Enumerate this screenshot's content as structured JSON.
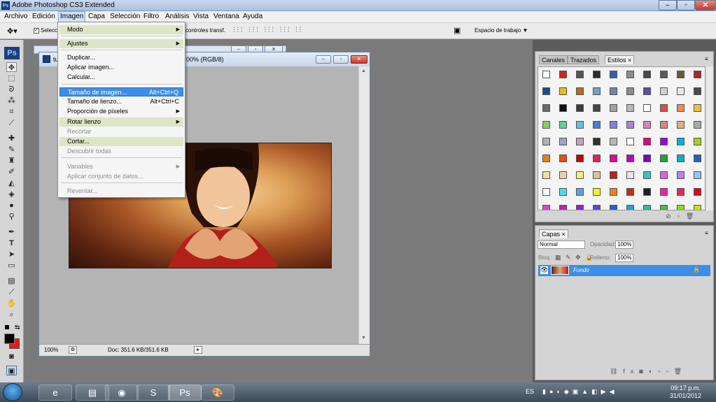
{
  "window": {
    "title": "Adobe Photoshop CS3 Extended",
    "app_icon": "Ps",
    "controls": [
      "minimize",
      "maximize",
      "close"
    ]
  },
  "menubar": [
    "Archivo",
    "Edición",
    "Imagen",
    "Capa",
    "Selección",
    "Filtro",
    "Análisis",
    "Vista",
    "Ventana",
    "Ayuda"
  ],
  "options_bar": {
    "select_label": "Selecci",
    "controls_label": "controles transf.",
    "workspace_label": "Espacio de trabajo ▼"
  },
  "image_menu": {
    "items": [
      {
        "label": "Modo",
        "shortcut": "",
        "submenu": true,
        "state": "submenu"
      },
      {
        "label": "Ajustes",
        "shortcut": "",
        "submenu": true,
        "state": "submenu"
      },
      {
        "label": "Duplicar...",
        "shortcut": "",
        "submenu": false,
        "state": "normal"
      },
      {
        "label": "Aplicar imagen...",
        "shortcut": "",
        "submenu": false,
        "state": "normal"
      },
      {
        "label": "Calcular...",
        "shortcut": "",
        "submenu": false,
        "state": "normal"
      },
      {
        "label": "Tamaño de imagen...",
        "shortcut": "Alt+Ctrl+Q",
        "submenu": false,
        "state": "highlighted"
      },
      {
        "label": "Tamaño de lienzo...",
        "shortcut": "Alt+Ctrl+C",
        "submenu": false,
        "state": "normal"
      },
      {
        "label": "Proporción de píxeles",
        "shortcut": "",
        "submenu": true,
        "state": "normal"
      },
      {
        "label": "Rotar lienzo",
        "shortcut": "",
        "submenu": true,
        "state": "submenu"
      },
      {
        "label": "Recortar",
        "shortcut": "",
        "submenu": false,
        "state": "disabled"
      },
      {
        "label": "Cortar...",
        "shortcut": "",
        "submenu": false,
        "state": "submenu"
      },
      {
        "label": "Descubrir todas",
        "shortcut": "",
        "submenu": false,
        "state": "disabled"
      },
      {
        "label": "Variables",
        "shortcut": "",
        "submenu": true,
        "state": "disabled"
      },
      {
        "label": "Aplicar conjunto de datos...",
        "shortcut": "",
        "submenu": false,
        "state": "disabled"
      },
      {
        "label": "Reventar...",
        "shortcut": "",
        "submenu": false,
        "state": "disabled"
      }
    ]
  },
  "document": {
    "title_prefix": "tu",
    "title_suffix": "00% (RGB/8)",
    "zoom": "100%",
    "doc_size": "Doc: 351.6 KB/351.6 KB"
  },
  "styles_panel": {
    "tabs": [
      "Canales",
      "Trazados",
      "Estilos ×"
    ],
    "active_tab": 2,
    "swatches": [
      [
        "#ffffff",
        "#c8281e",
        "#555555",
        "#2b2b2b",
        "#2f63a8",
        "#8c8c8c",
        "#4a4a4a",
        "#5a5a5a",
        "#6b5a32",
        "#b3212b"
      ],
      [
        "#1a4b8c",
        "#e0c01a",
        "#b56a25",
        "#6fa0d0",
        "#6b86a8",
        "#8c8c8c",
        "#5b4ea0",
        "#cfcfcf",
        "#e8e8e8",
        "#4a4a4a"
      ],
      [
        "#6a6a6a",
        "#111111",
        "#3c3c3c",
        "#454545",
        "#a0a0a0",
        "#b8b8b8",
        "#ffffff",
        "#dd4a4a",
        "#f08c50",
        "#f0c040"
      ],
      [
        "#80d060",
        "#60d0a0",
        "#60c0e0",
        "#4080e0",
        "#8080e0",
        "#b080e0",
        "#e080c0",
        "#e08080",
        "#e0b080",
        "#a0b0a0"
      ],
      [
        "#b0b0b0",
        "#a0a8c0",
        "#c0a0c0",
        "#303030",
        "#b8b8b8",
        "#ffffff",
        "#e00080",
        "#a000e0",
        "#00b0e0",
        "#a0d020"
      ],
      [
        "#e08020",
        "#e05000",
        "#c00000",
        "#e02060",
        "#e000a0",
        "#c000c0",
        "#8000c0",
        "#20a040",
        "#00b0c0",
        "#2060c0"
      ],
      [
        "#f0e0a0",
        "#f0d0b0",
        "#f0f080",
        "#e0c0a0",
        "#c02020",
        "#f0e0f0",
        "#40c0c0",
        "#e060e0",
        "#c080f0",
        "#a0c0f0"
      ],
      [
        "#ffffff",
        "#40e0f0",
        "#60a0e0",
        "#f0f020",
        "#f08020",
        "#c03010",
        "#202020",
        "#f020a0",
        "#f02060",
        "#e00020"
      ],
      [
        "#e040e0",
        "#c020c0",
        "#9020e0",
        "#6040e0",
        "#2060e0",
        "#20a0e0",
        "#20c0a0",
        "#40c040",
        "#80e020",
        "#c0e020"
      ]
    ]
  },
  "layers_panel": {
    "tab": "Capas ×",
    "blend_mode": "Normal",
    "opacity_label": "Opacidad:",
    "opacity": "100%",
    "lock_label": "Bloq.:",
    "fill_label": "Relleno:",
    "fill": "100%",
    "layer_name": "Fondo"
  },
  "taskbar": {
    "language": "ES",
    "time": "09:17 p.m.",
    "date": "31/01/2012",
    "apps": [
      "Internet Explorer",
      "Explorador",
      "Chrome",
      "Skype",
      "Photoshop",
      "Paint"
    ]
  },
  "colors": {
    "accent": "#3d8ee6",
    "menu_submenu_bg": "#dce5c4"
  }
}
